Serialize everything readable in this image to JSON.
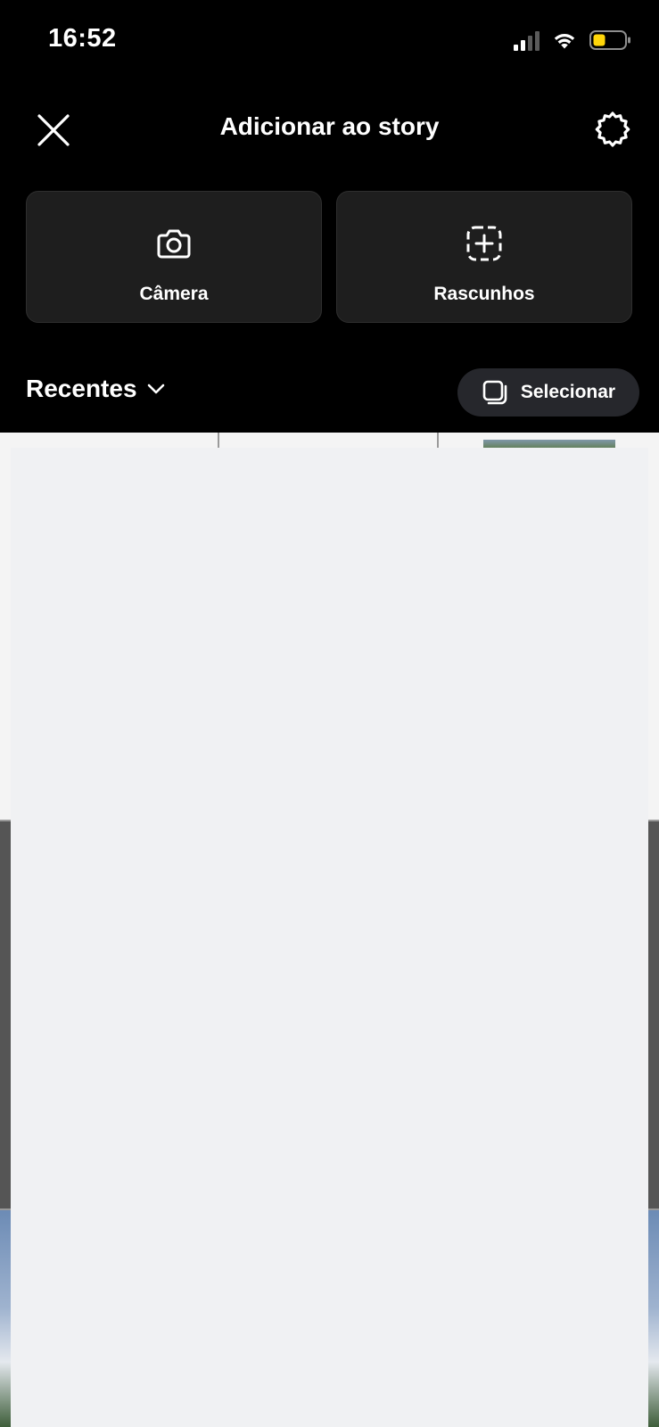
{
  "status_bar": {
    "time": "16:52",
    "signal_icon": "cellular-signal-icon",
    "wifi_icon": "wifi-icon",
    "battery_icon": "battery-icon",
    "battery_color": "#ffd60a"
  },
  "header": {
    "title": "Adicionar ao story",
    "close_icon": "close-icon",
    "settings_icon": "settings-gear-icon"
  },
  "actions": {
    "camera_label": "Câmera",
    "camera_icon": "camera-icon",
    "drafts_label": "Rascunhos",
    "drafts_icon": "dashed-plus-square-icon"
  },
  "gallery": {
    "album_title": "Recentes",
    "album_icon": "chevron-down-icon",
    "select_label": "Selecionar",
    "select_icon": "multi-select-icon"
  },
  "colors": {
    "background": "#000000",
    "card_background": "#1e1e1e",
    "pill_background": "#26272c",
    "gallery_overlay": "#f0f1f3"
  }
}
